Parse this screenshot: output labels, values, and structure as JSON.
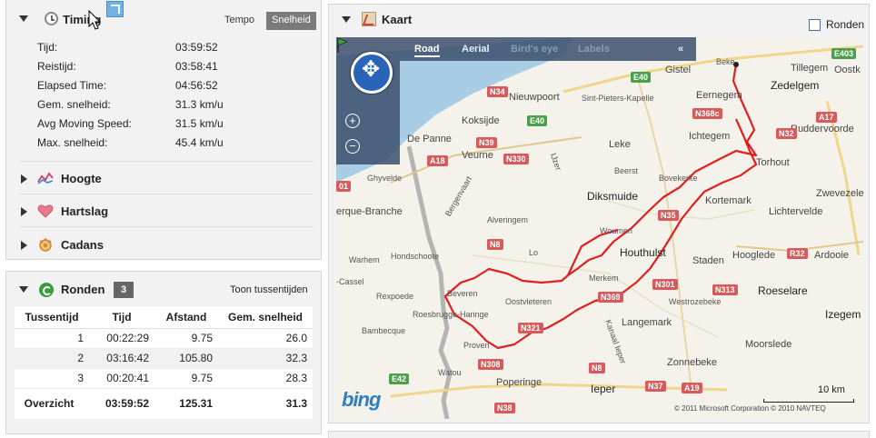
{
  "timing": {
    "title": "Timing",
    "tempo_label": "Tempo",
    "snelheid_label": "Snelheid",
    "stats": [
      {
        "label": "Tijd:",
        "value": "03:59:52"
      },
      {
        "label": "Reistijd:",
        "value": "03:58:41"
      },
      {
        "label": "Elapsed Time:",
        "value": "04:56:52"
      },
      {
        "label": "Gem. snelheid:",
        "value": "31.3 km/u"
      },
      {
        "label": "Avg Moving Speed:",
        "value": "31.5 km/u"
      },
      {
        "label": "Max. snelheid:",
        "value": "45.4 km/u"
      }
    ],
    "sections": [
      {
        "label": "Hoogte",
        "icon": "elevation-icon"
      },
      {
        "label": "Hartslag",
        "icon": "heart-icon"
      },
      {
        "label": "Cadans",
        "icon": "cadence-icon"
      }
    ]
  },
  "ronden": {
    "title": "Ronden",
    "count": "3",
    "toon_label": "Toon tussentijden",
    "columns": [
      "Tussentijd",
      "Tijd",
      "Afstand",
      "Gem. snelheid"
    ],
    "rows": [
      {
        "lap": "1",
        "time": "00:22:29",
        "distance": "9.75",
        "speed": "26.0"
      },
      {
        "lap": "2",
        "time": "03:16:42",
        "distance": "105.80",
        "speed": "32.3"
      },
      {
        "lap": "3",
        "time": "00:20:41",
        "distance": "9.75",
        "speed": "28.3"
      }
    ],
    "total": {
      "label": "Overzicht",
      "time": "03:59:52",
      "distance": "125.31",
      "speed": "31.3"
    }
  },
  "kaart": {
    "title": "Kaart",
    "ronden_checkbox_label": "Ronden",
    "tabs": {
      "road": "Road",
      "aerial": "Aerial",
      "birdseye": "Bird's eye",
      "labels": "Labels",
      "collapse": "«"
    },
    "zoom_in": "+",
    "zoom_out": "−",
    "bing": "bing",
    "copyright": "© 2011 Microsoft Corporation   © 2010 NAVTEQ",
    "scale": "10 km",
    "places": {
      "gistel": "Gistel",
      "beke": "Beke",
      "zedelgem": "Zedelgem",
      "tillegem": "Tillegem",
      "oostk": "Oostk",
      "nieuwpoort": "Nieuwpoort",
      "sint_pieters": "Sint-Pieters-Kapelle",
      "eernegem": "Eernegem",
      "koksijde": "Koksijde",
      "ichtegem": "Ichtegem",
      "ruddervoorde": "Ruddervoorde",
      "depanne": "De Panne",
      "veurne": "Veurne",
      "leke": "Leke",
      "torhout": "Torhout",
      "beerst": "Beerst",
      "bovekerke": "Bovekerke",
      "ghyvelde": "Ghyvelde",
      "diksmuide": "Diksmuide",
      "kortemark": "Kortemark",
      "zwevezele": "Zwevezele",
      "lichtervelde": "Lichtervelde",
      "erque": "erque-Branche",
      "alveringem": "Alveringem",
      "woumen": "Woumen",
      "houthulst": "Houthulst",
      "lo": "Lo",
      "staden": "Staden",
      "ardooie": "Ardooie",
      "hooglede": "Hooglede",
      "warhem": "Warhem",
      "hondschoote": "Hondschoote",
      "merkem": "Merkem",
      "roeselare": "Roeselare",
      "cassel": "-Cassel",
      "rexpoede": "Rexpoede",
      "beveren": "Beveren",
      "oostvleteren": "Oostvleteren",
      "westrozebeke": "Westrozebeke",
      "izegem": "Izegem",
      "roesbrugge": "Roesbrugge-Haringe",
      "langemark": "Langemark",
      "bambecque": "Bambecque",
      "proven": "Proven",
      "moorslede": "Moorslede",
      "zonnebeke": "Zonnebeke",
      "watou": "Watou",
      "poperinge": "Poperinge",
      "ieper": "Ieper",
      "bergenvaart": "Bergenvaart",
      "ijzer": "IJzer",
      "kanaal": "Kanaal Ieper"
    },
    "roads": {
      "e403": "E403",
      "e40a": "E40",
      "e40b": "E40",
      "n34": "N34",
      "n368": "N368c",
      "a17": "A17",
      "n32a": "N32",
      "n39": "N39",
      "n330": "N330",
      "a18": "A18",
      "n35": "N35",
      "n8a": "N8",
      "r32": "R32",
      "n301": "N301",
      "n313": "N313",
      "n369": "N369",
      "n321": "N321",
      "n308": "N308",
      "n8b": "N8",
      "e42": "E42",
      "n38": "N38",
      "n37": "N37",
      "a19": "A19",
      "n01": "01"
    }
  }
}
